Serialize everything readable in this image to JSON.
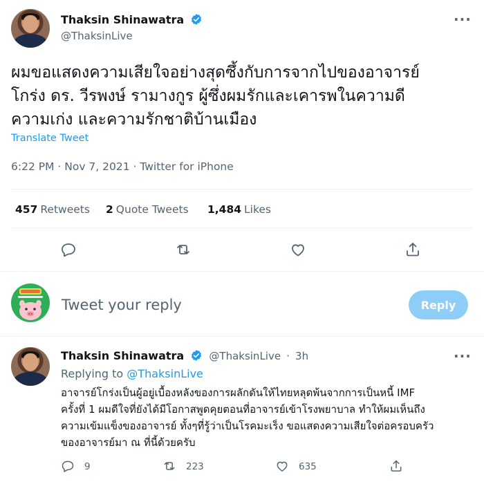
{
  "tweet": {
    "author_name": "Thaksin Shinawatra",
    "author_handle": "@ThaksinLive",
    "more_label": "···",
    "text_lines": [
      "ผมขอแสดงความเสียใจอย่างสุดซึ้งกับการจากไปของอาจารย์",
      "โกร่ง ดร. วีรพงษ์ รามางกูร ผู้ซึ่งผมรักและเคารพในความดี",
      "ความเก่ง และความรักชาติบ้านเมือง"
    ],
    "translate_label": "Translate Tweet",
    "timestamp": "6:22 PM · Nov 7, 2021 · Twitter for iPhone",
    "stats": {
      "retweets_count": "457",
      "retweets_label": "Retweets",
      "quotes_count": "2",
      "quotes_label": "Quote Tweets",
      "likes_count": "1,484",
      "likes_label": "Likes"
    },
    "actions": [
      "reply-icon",
      "retweet-icon",
      "like-icon",
      "share-icon"
    ]
  },
  "composer": {
    "placeholder": "Tweet your reply",
    "button_label": "Reply"
  },
  "reply": {
    "author_name": "Thaksin Shinawatra",
    "author_handle": "@ThaksinLive",
    "separator": "·",
    "time": "3h",
    "more_label": "···",
    "replying_prefix": "Replying to",
    "replying_handle": "@ThaksinLive",
    "text_lines": [
      "อาจารย์โกร่งเป็นผู้อยู่เบื้องหลังของการผลักดันให้ไทยหลุดพ้นจากการเป็นหนี้ IMF",
      "ครั้งที่ 1  ผมดีใจที่ยังได้มีโอกาสพูดคุยตอนที่อาจารย์เข้าโรงพยาบาล ทำให้ผมเห็นถึง",
      "ความเข้มแข็งของอาจารย์ ทั้งๆที่รู้ว่าเป็นโรคมะเร็ง ขอแสดงความเสียใจต่อครอบครัว",
      "ของอาจารย์มา ณ ที่นี้ด้วยครับ"
    ],
    "reply_count": "9",
    "retweet_count": "223",
    "like_count": "635"
  },
  "colors": {
    "accent": "#1d9bf0",
    "reply_button_disabled": "#8ecdf7",
    "text_secondary": "#536471"
  }
}
